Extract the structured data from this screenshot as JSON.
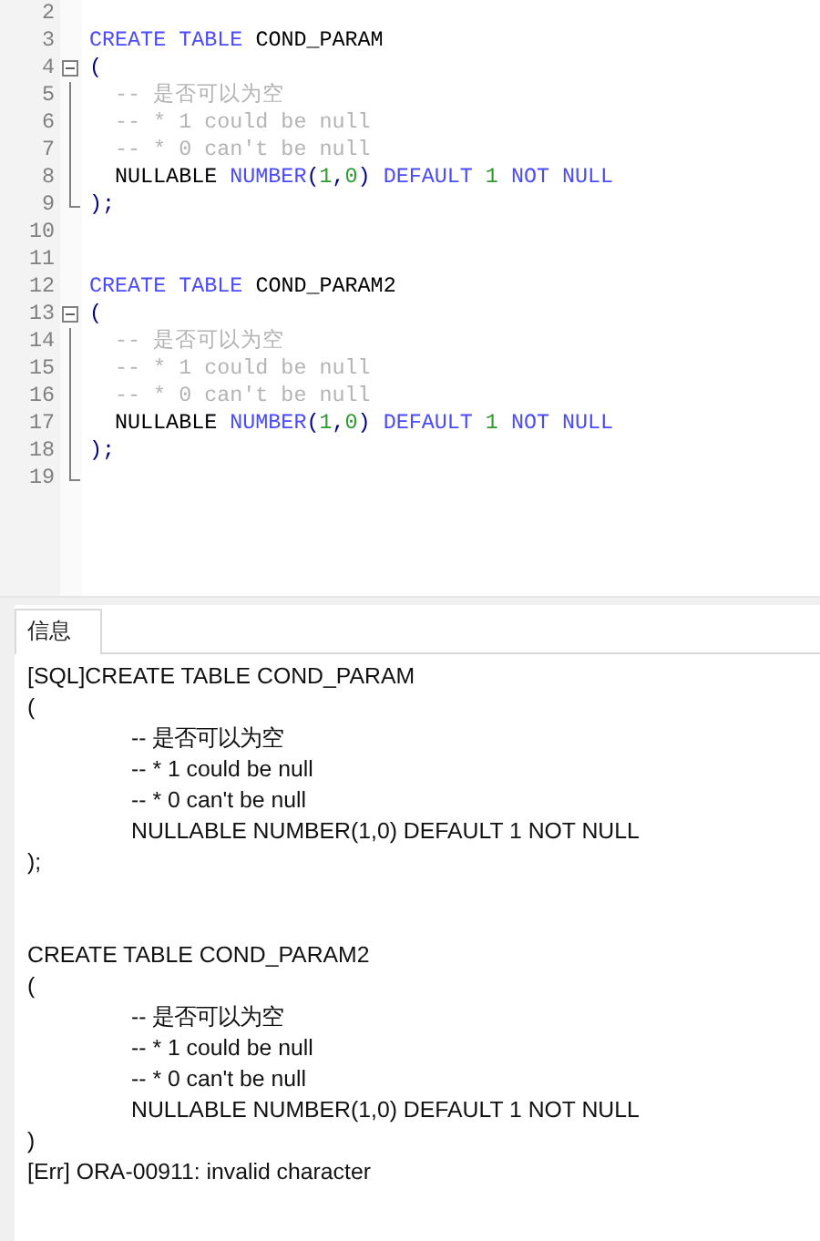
{
  "editor": {
    "lines": [
      {
        "number": "2"
      },
      {
        "number": "3",
        "kind": "plain",
        "tokens": [
          {
            "text": "CREATE TABLE ",
            "kind": "keyword"
          },
          {
            "text": "COND_PARAM",
            "kind": "ident"
          }
        ]
      },
      {
        "number": "4",
        "kind": "plain",
        "expanded": true,
        "tokens": [
          {
            "text": "(",
            "kind": "punct"
          }
        ],
        "children": [
          {
            "number": "5",
            "kind": "indented",
            "tokens": [
              {
                "text": "-- 是否可以为空",
                "kind": "comment"
              }
            ]
          },
          {
            "number": "6",
            "kind": "indented",
            "tokens": [
              {
                "text": "-- * 1 could be null",
                "kind": "comment"
              }
            ]
          },
          {
            "number": "7",
            "kind": "indented",
            "tokens": [
              {
                "text": "-- * 0 can't be null",
                "kind": "comment"
              }
            ]
          },
          {
            "number": "8",
            "kind": "indented",
            "tokens": [
              {
                "text": "NULLABLE ",
                "kind": "ident"
              },
              {
                "text": "NUMBER",
                "kind": "keyword"
              },
              {
                "text": "(",
                "kind": "punct"
              },
              {
                "text": "1",
                "kind": "number"
              },
              {
                "text": ",",
                "kind": "punct"
              },
              {
                "text": "0",
                "kind": "number"
              },
              {
                "text": ") ",
                "kind": "punct"
              },
              {
                "text": "DEFAULT ",
                "kind": "keyword"
              },
              {
                "text": "1 ",
                "kind": "number"
              },
              {
                "text": "NOT NULL",
                "kind": "keyword"
              }
            ]
          },
          {
            "number": "9",
            "kind": "plain",
            "tokens": [
              {
                "text": ");",
                "kind": "punct"
              }
            ]
          }
        ]
      },
      {
        "number": "10"
      },
      {
        "number": "11"
      },
      {
        "number": "12",
        "kind": "plain",
        "tokens": [
          {
            "text": "CREATE TABLE ",
            "kind": "keyword"
          },
          {
            "text": "COND_PARAM2",
            "kind": "ident"
          }
        ]
      },
      {
        "number": "13",
        "kind": "plain",
        "expanded": true,
        "tokens": [
          {
            "text": "(",
            "kind": "punct"
          }
        ],
        "children": [
          {
            "number": "14",
            "kind": "indented",
            "tokens": [
              {
                "text": "-- 是否可以为空",
                "kind": "comment"
              }
            ]
          },
          {
            "number": "15",
            "kind": "indented",
            "tokens": [
              {
                "text": "-- * 1 could be null",
                "kind": "comment"
              }
            ]
          },
          {
            "number": "16",
            "kind": "indented",
            "tokens": [
              {
                "text": "-- * 0 can't be null",
                "kind": "comment"
              }
            ]
          },
          {
            "number": "17",
            "kind": "indented",
            "tokens": [
              {
                "text": "NULLABLE ",
                "kind": "ident"
              },
              {
                "text": "NUMBER",
                "kind": "keyword"
              },
              {
                "text": "(",
                "kind": "punct"
              },
              {
                "text": "1",
                "kind": "number"
              },
              {
                "text": ",",
                "kind": "punct"
              },
              {
                "text": "0",
                "kind": "number"
              },
              {
                "text": ") ",
                "kind": "punct"
              },
              {
                "text": "DEFAULT ",
                "kind": "keyword"
              },
              {
                "text": "1 ",
                "kind": "number"
              },
              {
                "text": "NOT NULL",
                "kind": "keyword"
              }
            ]
          },
          {
            "number": "18",
            "kind": "plain",
            "tokens": [
              {
                "text": ");",
                "kind": "punct"
              }
            ]
          },
          {
            "number": "19"
          }
        ]
      }
    ]
  },
  "output": {
    "tabs": [
      {
        "label": "信息",
        "selected": true
      }
    ],
    "blocks": [
      [
        {
          "text": "[SQL]CREATE TABLE COND_PARAM",
          "kind": "plain"
        },
        {
          "text": "(",
          "kind": "plain"
        },
        {
          "text": "-- 是否可以为空",
          "kind": "indented"
        },
        {
          "text": "-- * 1 could be null",
          "kind": "indented"
        },
        {
          "text": "-- * 0 can't be null",
          "kind": "indented"
        },
        {
          "text": "NULLABLE NUMBER(1,0) DEFAULT 1 NOT NULL",
          "kind": "indented"
        },
        {
          "text": ");",
          "kind": "plain"
        }
      ],
      [
        {
          "text": "CREATE TABLE COND_PARAM2",
          "kind": "plain"
        },
        {
          "text": "(",
          "kind": "plain"
        },
        {
          "text": "-- 是否可以为空",
          "kind": "indented"
        },
        {
          "text": "-- * 1 could be null",
          "kind": "indented"
        },
        {
          "text": "-- * 0 can't be null",
          "kind": "indented"
        },
        {
          "text": "NULLABLE NUMBER(1,0) DEFAULT 1 NOT NULL",
          "kind": "indented"
        },
        {
          "text": ")",
          "kind": "plain"
        },
        {
          "text": "[Err] ORA-00911: invalid character",
          "kind": "plain"
        }
      ]
    ]
  }
}
